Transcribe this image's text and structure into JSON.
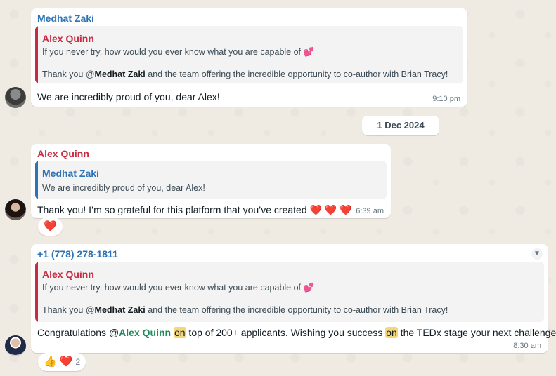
{
  "messages": [
    {
      "sender": "Medhat Zaki",
      "quote": {
        "author": "Alex Quinn",
        "line1": "If you never try, how would you ever know what you are capable of 💕",
        "line2_pre": "Thank you @",
        "line2_mention": "Medhat Zaki",
        "line2_post": " and the team offering the incredible opportunity to co-author with Brian Tracy!"
      },
      "text": "We are incredibly proud of you, dear Alex!",
      "time": "9:10 pm"
    },
    {
      "sender": "Alex Quinn",
      "quote": {
        "author": "Medhat Zaki",
        "line1": "We are incredibly proud of you, dear Alex!"
      },
      "text": "Thank you! I’m so grateful for this platform that you’ve created ❤️ ❤️ ❤️",
      "time": "6:39 am",
      "reaction": "❤️"
    },
    {
      "sender": "+1 (778) 278-1811",
      "quote": {
        "author": "Alex Quinn",
        "line1": "If you never try, how would you ever know what you are capable of 💕",
        "line2_pre": "Thank you @",
        "line2_mention": "Medhat Zaki",
        "line2_post": " and the team offering the incredible opportunity to co-author with Brian Tracy!"
      },
      "text_a": "Congratulations @",
      "text_mention": "Alex Quinn",
      "text_b": " ",
      "text_hl1": "on",
      "text_c": " top of 200+ applicants.  Wishing you success ",
      "text_hl2": "on",
      "text_d": " the TEDx stage your next challenge.",
      "time": "8:30 am",
      "reactions": "👍 ❤️",
      "reaction_count": "2"
    }
  ],
  "date_separator": "1 Dec 2024",
  "icons": {
    "menu_chevron": "chevron-down-icon"
  },
  "colors": {
    "sender_blue": "#2d73b5",
    "sender_red": "#c72c41",
    "mention_green": "#1f8a5a",
    "highlight": "#f5d77a"
  }
}
